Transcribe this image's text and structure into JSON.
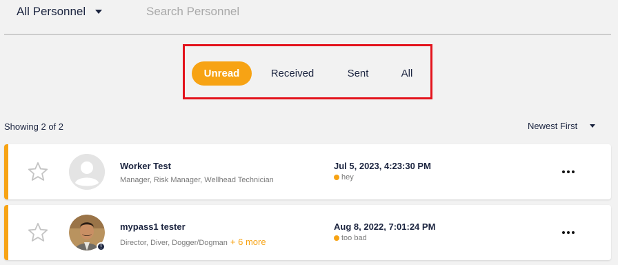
{
  "header": {
    "filter_label": "All Personnel",
    "search_placeholder": "Search Personnel",
    "search_value": ""
  },
  "tabs": [
    {
      "label": "Unread",
      "active": true
    },
    {
      "label": "Received",
      "active": false
    },
    {
      "label": "Sent",
      "active": false
    },
    {
      "label": "All",
      "active": false
    }
  ],
  "summary": {
    "showing_text": "Showing 2 of 2",
    "sort_label": "Newest First"
  },
  "messages": [
    {
      "name": "Worker Test",
      "roles": "Manager, Risk Manager, Wellhead Technician",
      "more": "",
      "date": "Jul 5, 2023, 4:23:30 PM",
      "preview": "hey",
      "avatar": "default-avatar-icon",
      "starred": false
    },
    {
      "name": "mypass1 tester",
      "roles": "Director, Diver, Dogger/Dogman",
      "more": "+ 6 more",
      "date": "Aug 8, 2022, 7:01:24 PM",
      "preview": "too bad",
      "avatar": "profile-photo",
      "badge": "!",
      "starred": false
    }
  ],
  "colors": {
    "accent": "#f7a314",
    "text": "#1c2540",
    "highlight_border": "#e3131c",
    "background": "#f2f2f2"
  }
}
